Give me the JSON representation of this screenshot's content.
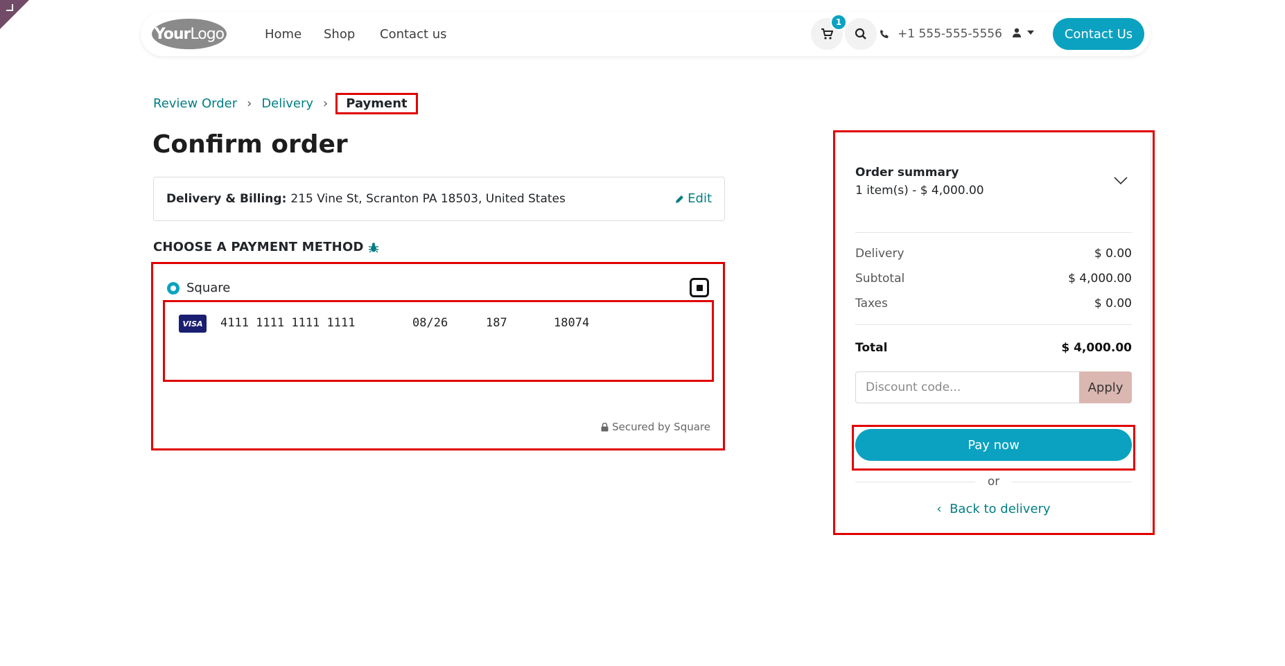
{
  "header": {
    "logo": {
      "bold": "Your",
      "light": "Logo"
    },
    "nav": [
      "Home",
      "Shop",
      "Contact us"
    ],
    "cart_count": "1",
    "phone": "+1 555-555-5556",
    "contact_button": "Contact Us"
  },
  "breadcrumb": {
    "review": "Review Order",
    "delivery": "Delivery",
    "payment": "Payment"
  },
  "page_title": "Confirm order",
  "address": {
    "label": "Delivery & Billing:",
    "value": "215 Vine St, Scranton PA 18503, United States",
    "edit": "Edit"
  },
  "payment": {
    "section_title": "CHOOSE A PAYMENT METHOD",
    "method_name": "Square",
    "card_brand": "VISA",
    "card_number": "4111 1111 1111 1111",
    "expiry": "08/26",
    "cvv": "187",
    "postal": "18074",
    "secured": "Secured by Square"
  },
  "summary": {
    "title": "Order summary",
    "items": "1 item(s) -  $ 4,000.00",
    "delivery_label": "Delivery",
    "delivery_value": "$ 0.00",
    "subtotal_label": "Subtotal",
    "subtotal_value": "$ 4,000.00",
    "taxes_label": "Taxes",
    "taxes_value": "$ 0.00",
    "total_label": "Total",
    "total_value": "$ 4,000.00",
    "discount_placeholder": "Discount code...",
    "apply": "Apply",
    "pay_now": "Pay now",
    "or": "or",
    "back": "Back to delivery"
  },
  "colors": {
    "primary": "#0aa2c0",
    "link": "#017e84",
    "highlight": "#e00000",
    "apply_bg": "#dbb7b1"
  }
}
